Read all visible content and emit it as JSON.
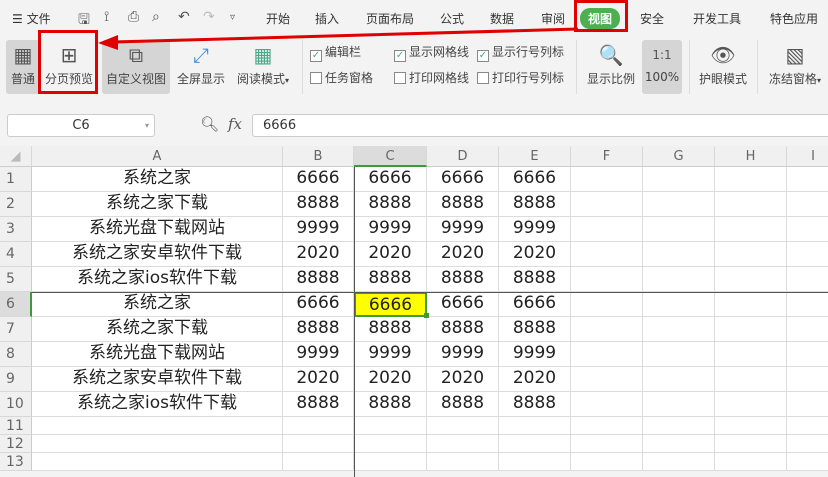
{
  "menu": {
    "file": "文件",
    "tabs": [
      "开始",
      "插入",
      "页面布局",
      "公式",
      "数据",
      "审阅",
      "视图",
      "安全",
      "开发工具",
      "特色应用"
    ],
    "active_tab": "视图"
  },
  "ribbon": {
    "normal": "普通",
    "page_break": "分页预览",
    "custom_view": "自定义视图",
    "fullscreen": "全屏显示",
    "reading_mode": "阅读模式",
    "checks": [
      {
        "label": "编辑栏",
        "checked": true
      },
      {
        "label": "显示网格线",
        "checked": true
      },
      {
        "label": "显示行号列标",
        "checked": true
      },
      {
        "label": "任务窗格",
        "checked": false
      },
      {
        "label": "打印网格线",
        "checked": false
      },
      {
        "label": "打印行号列标",
        "checked": false
      }
    ],
    "zoom": "显示比例",
    "zoom_100": "100%",
    "zoom_100_icon": "1:1",
    "eye_mode": "护眼模式",
    "freeze": "冻结窗格"
  },
  "formula": {
    "name_box": "C6",
    "fx": "fx",
    "value": "6666"
  },
  "sheet": {
    "columns": [
      "A",
      "B",
      "C",
      "D",
      "E",
      "F",
      "G",
      "H",
      "I"
    ],
    "selected_cell": "C6",
    "rows": [
      [
        "系统之家",
        "6666",
        "6666",
        "6666",
        "6666"
      ],
      [
        "系统之家下载",
        "8888",
        "8888",
        "8888",
        "8888"
      ],
      [
        "系统光盘下载网站",
        "9999",
        "9999",
        "9999",
        "9999"
      ],
      [
        "系统之家安卓软件下载",
        "2020",
        "2020",
        "2020",
        "2020"
      ],
      [
        "系统之家ios软件下载",
        "8888",
        "8888",
        "8888",
        "8888"
      ],
      [
        "系统之家",
        "6666",
        "6666",
        "6666",
        "6666"
      ],
      [
        "系统之家下载",
        "8888",
        "8888",
        "8888",
        "8888"
      ],
      [
        "系统光盘下载网站",
        "9999",
        "9999",
        "9999",
        "9999"
      ],
      [
        "系统之家安卓软件下载",
        "2020",
        "2020",
        "2020",
        "2020"
      ],
      [
        "系统之家ios软件下载",
        "8888",
        "8888",
        "8888",
        "8888"
      ],
      [],
      [],
      []
    ]
  },
  "colors": {
    "accent": "#4caf50",
    "annotation": "#e00000",
    "highlight": "#ffff00"
  }
}
